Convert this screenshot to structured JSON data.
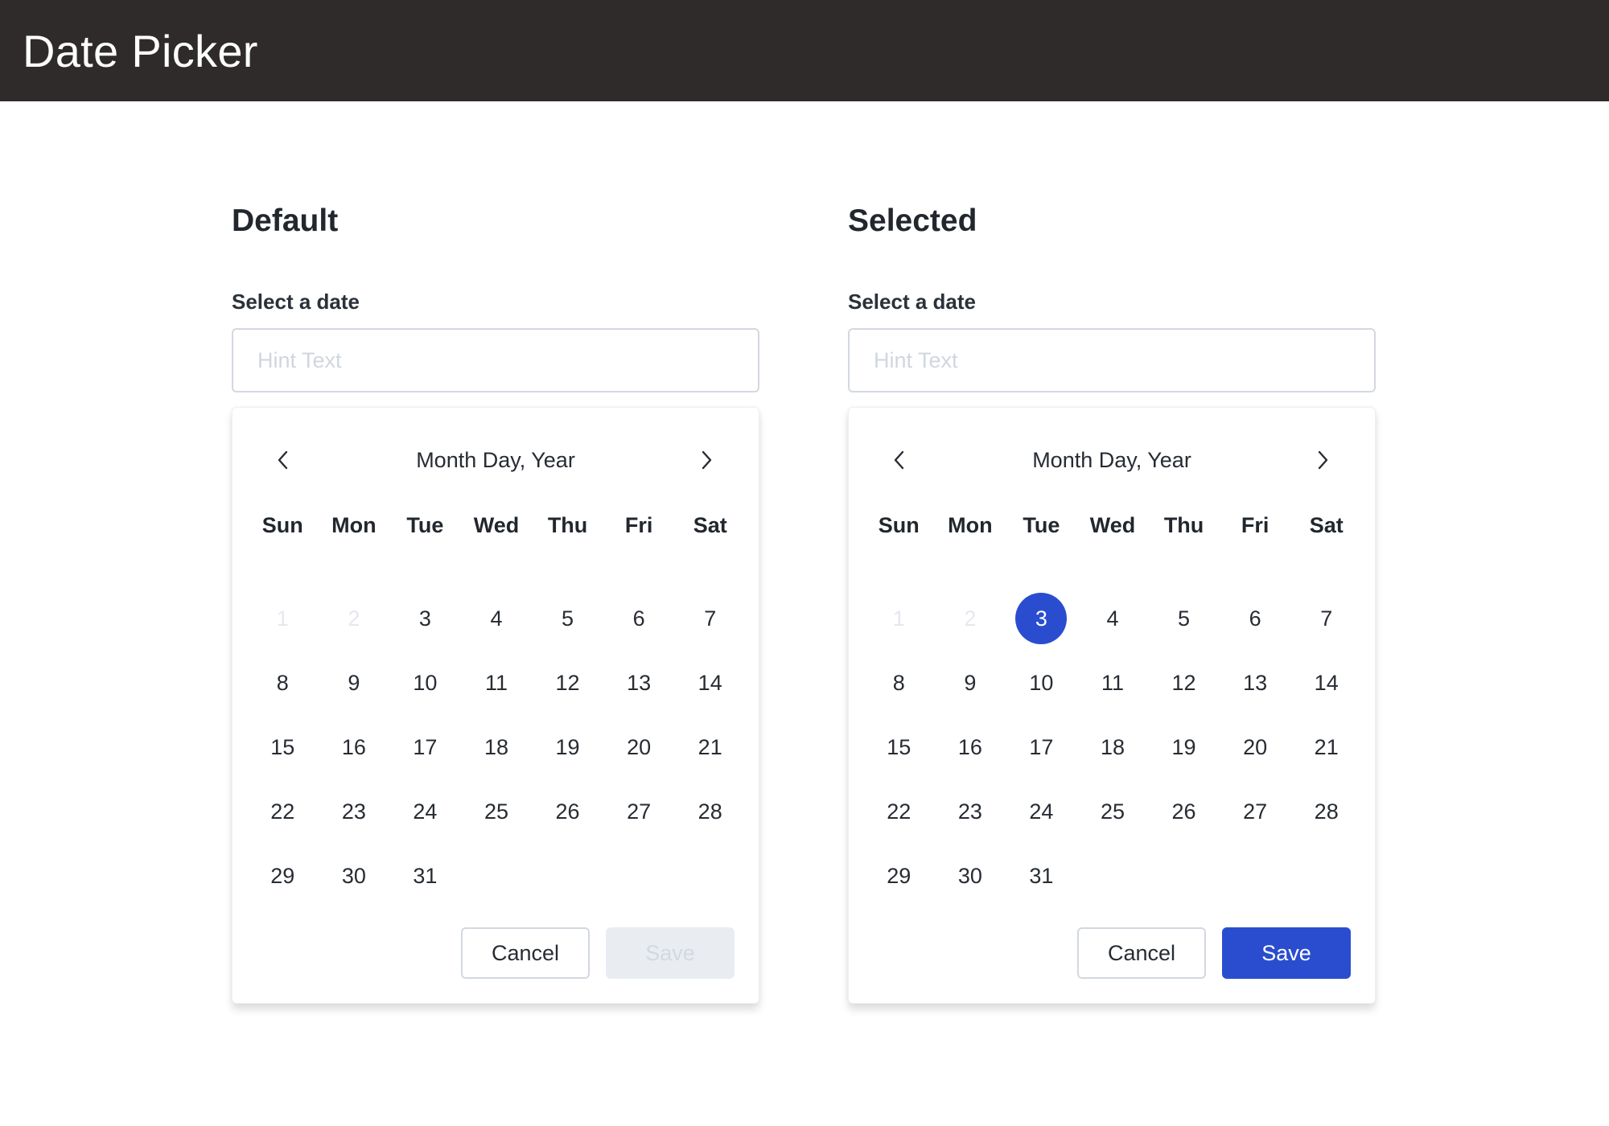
{
  "header": {
    "title": "Date Picker"
  },
  "colors": {
    "header_bg": "#2f2b2a",
    "accent": "#2a4dd0",
    "disabled_bg": "#e9edf2",
    "border": "#d3d8e0"
  },
  "pickers": [
    {
      "section_title": "Default",
      "field_label": "Select a date",
      "input": {
        "value": "",
        "placeholder": "Hint Text"
      },
      "calendar": {
        "title": "Month Day, Year",
        "prev_icon": "chevron-left-icon",
        "next_icon": "chevron-right-icon",
        "weekdays": [
          "Sun",
          "Mon",
          "Tue",
          "Wed",
          "Thu",
          "Fri",
          "Sat"
        ],
        "days": [
          "1",
          "2",
          "3",
          "4",
          "5",
          "6",
          "7",
          "8",
          "9",
          "10",
          "11",
          "12",
          "13",
          "14",
          "15",
          "16",
          "17",
          "18",
          "19",
          "20",
          "21",
          "22",
          "23",
          "24",
          "25",
          "26",
          "27",
          "28",
          "29",
          "30",
          "31"
        ],
        "disabled_days": [
          "1",
          "2"
        ],
        "selected_day": null
      },
      "actions": {
        "cancel_label": "Cancel",
        "save_label": "Save",
        "save_enabled": false
      }
    },
    {
      "section_title": "Selected",
      "field_label": "Select a date",
      "input": {
        "value": "",
        "placeholder": "Hint Text"
      },
      "calendar": {
        "title": "Month Day, Year",
        "prev_icon": "chevron-left-icon",
        "next_icon": "chevron-right-icon",
        "weekdays": [
          "Sun",
          "Mon",
          "Tue",
          "Wed",
          "Thu",
          "Fri",
          "Sat"
        ],
        "days": [
          "1",
          "2",
          "3",
          "4",
          "5",
          "6",
          "7",
          "8",
          "9",
          "10",
          "11",
          "12",
          "13",
          "14",
          "15",
          "16",
          "17",
          "18",
          "19",
          "20",
          "21",
          "22",
          "23",
          "24",
          "25",
          "26",
          "27",
          "28",
          "29",
          "30",
          "31"
        ],
        "disabled_days": [
          "1",
          "2"
        ],
        "selected_day": "3"
      },
      "actions": {
        "cancel_label": "Cancel",
        "save_label": "Save",
        "save_enabled": true
      }
    }
  ]
}
